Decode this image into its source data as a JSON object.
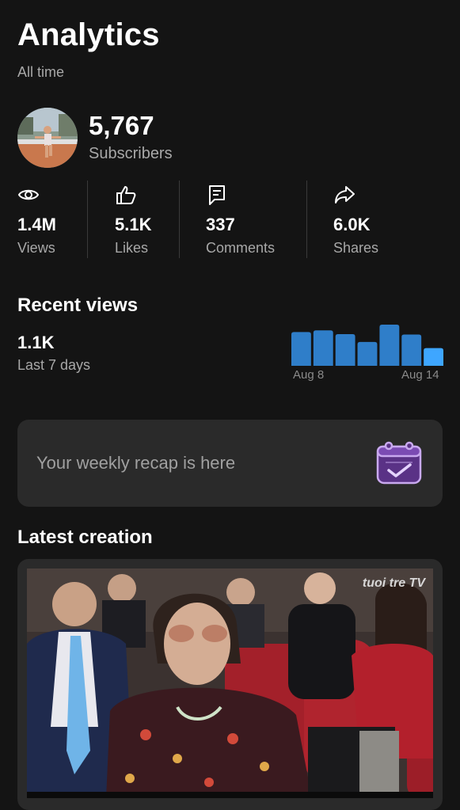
{
  "header": {
    "title": "Analytics",
    "period": "All time"
  },
  "channel": {
    "subscriber_count": "5,767",
    "subscriber_label": "Subscribers",
    "avatar_icon": "runner-avatar"
  },
  "stats": [
    {
      "icon": "eye-icon",
      "value": "1.4M",
      "label": "Views"
    },
    {
      "icon": "thumbs-up-icon",
      "value": "5.1K",
      "label": "Likes"
    },
    {
      "icon": "comment-icon",
      "value": "337",
      "label": "Comments"
    },
    {
      "icon": "share-icon",
      "value": "6.0K",
      "label": "Shares"
    }
  ],
  "recent_views": {
    "title": "Recent views",
    "value": "1.1K",
    "period": "Last 7 days",
    "axis_start": "Aug 8",
    "axis_end": "Aug 14"
  },
  "chart_data": {
    "type": "bar",
    "categories": [
      "Aug 8",
      "Aug 9",
      "Aug 10",
      "Aug 11",
      "Aug 12",
      "Aug 13",
      "Aug 14"
    ],
    "values": [
      0.82,
      0.86,
      0.77,
      0.58,
      1.0,
      0.76,
      0.43
    ],
    "bar_color": "#2f7ec9",
    "highlight_color": "#3ea6ff",
    "highlight_index": 6
  },
  "recap": {
    "text": "Your weekly recap is here",
    "icon": "calendar-check-icon",
    "accent": "#7b4bb3"
  },
  "latest": {
    "title": "Latest creation",
    "watermark": "tuoi tre TV"
  }
}
